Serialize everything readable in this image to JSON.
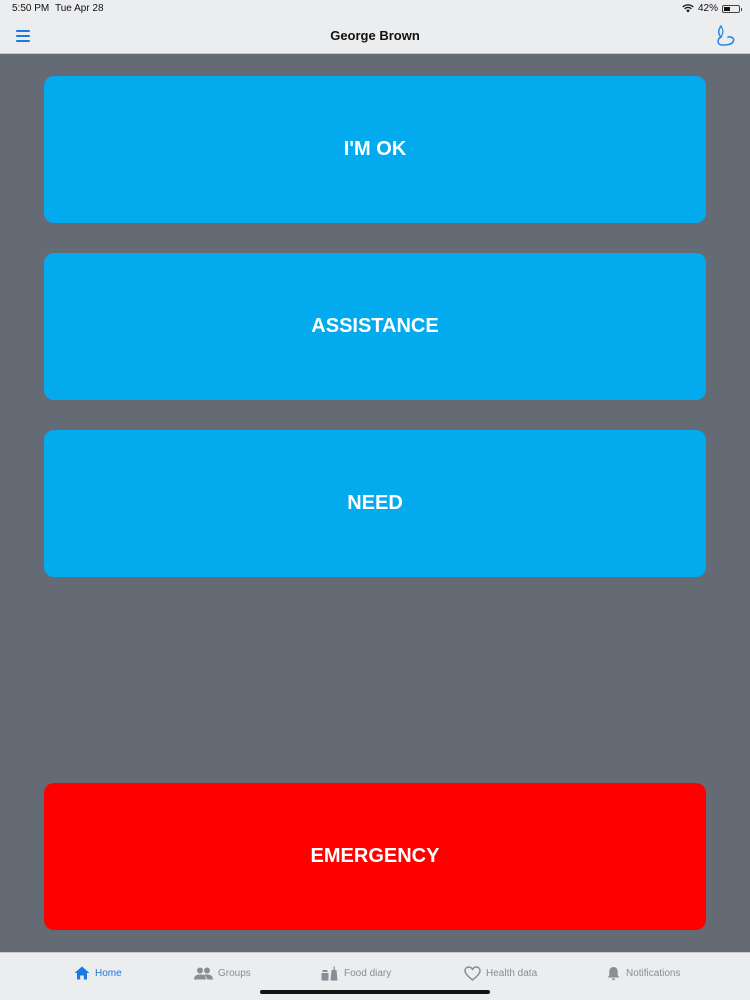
{
  "status_bar": {
    "time": "5:50 PM",
    "date": "Tue Apr 28",
    "battery_text": "42%",
    "battery_level": 0.42
  },
  "nav_bar": {
    "title": "George Brown",
    "left_icon": "hamburger-menu-icon",
    "right_icon": "app-logo-icon"
  },
  "actions": {
    "ok_label": "I'M OK",
    "assistance_label": "ASSISTANCE",
    "need_label": "NEED",
    "emergency_label": "EMERGENCY"
  },
  "tabs": [
    {
      "label": "Home",
      "icon": "home-icon",
      "active": true
    },
    {
      "label": "Groups",
      "icon": "groups-icon",
      "active": false
    },
    {
      "label": "Food diary",
      "icon": "food-diary-icon",
      "active": false
    },
    {
      "label": "Health data",
      "icon": "heart-icon",
      "active": false
    },
    {
      "label": "Notifications",
      "icon": "bell-icon",
      "active": false
    }
  ],
  "colors": {
    "background": "#656b75",
    "action_blue": "#03aaee",
    "emergency_red": "#ff0000",
    "accent": "#1a7ae0",
    "bar_background": "#ecedef"
  }
}
